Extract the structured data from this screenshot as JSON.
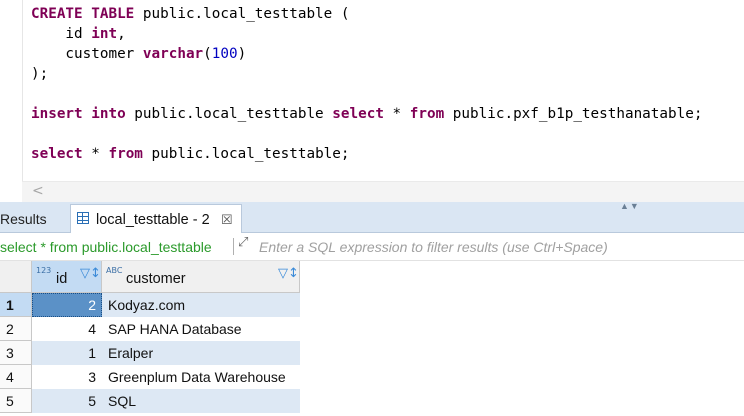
{
  "editor": {
    "lines": [
      [
        {
          "t": "CREATE TABLE",
          "c": "kw"
        },
        {
          "t": " public.local_testtable ("
        }
      ],
      [
        {
          "t": "    id "
        },
        {
          "t": "int",
          "c": "kw"
        },
        {
          "t": ","
        }
      ],
      [
        {
          "t": "    customer "
        },
        {
          "t": "varchar",
          "c": "kw"
        },
        {
          "t": "("
        },
        {
          "t": "100",
          "c": "num"
        },
        {
          "t": ")"
        }
      ],
      [
        {
          "t": ")"
        },
        {
          "t": ";",
          "c": "semi"
        }
      ],
      [],
      [
        {
          "t": "insert into",
          "c": "kw"
        },
        {
          "t": " public.local_testtable "
        },
        {
          "t": "select",
          "c": "kw"
        },
        {
          "t": " * "
        },
        {
          "t": "from",
          "c": "kw"
        },
        {
          "t": " public.pxf_b1p_testhanatable;"
        }
      ],
      [],
      [
        {
          "t": "select",
          "c": "kw"
        },
        {
          "t": " * "
        },
        {
          "t": "from",
          "c": "kw"
        },
        {
          "t": " public.local_testtable;"
        }
      ]
    ],
    "scroll_left_glyph": "<"
  },
  "tabs": {
    "results_label": "Results",
    "active_label": "local_testtable - 2",
    "close_glyph": "☒",
    "collapse_glyph": "▲▼"
  },
  "filter": {
    "query": "select * from public.local_testtable",
    "expand_glyph": "⤢",
    "placeholder": "Enter a SQL expression to filter results (use Ctrl+Space)"
  },
  "grid": {
    "columns": [
      {
        "type_badge": "123",
        "name": "id",
        "sort_glyph": "▽↕"
      },
      {
        "type_badge": "ABC",
        "name": "customer",
        "sort_glyph": "▽↕"
      }
    ],
    "rows": [
      {
        "n": "1",
        "id": "2",
        "customer": "Kodyaz.com"
      },
      {
        "n": "2",
        "id": "4",
        "customer": "SAP HANA Database"
      },
      {
        "n": "3",
        "id": "1",
        "customer": "Eralper"
      },
      {
        "n": "4",
        "id": "3",
        "customer": "Greenplum Data Warehouse"
      },
      {
        "n": "5",
        "id": "5",
        "customer": "SQL"
      }
    ],
    "selected_row": 0
  },
  "colors": {
    "keyword": "#7f0055",
    "number": "#0000c0",
    "filter_query": "#2b9a2b",
    "tabbar": "#dae6f3",
    "selected_cell": "#5b91c7",
    "alt_row": "#dde8f4"
  }
}
